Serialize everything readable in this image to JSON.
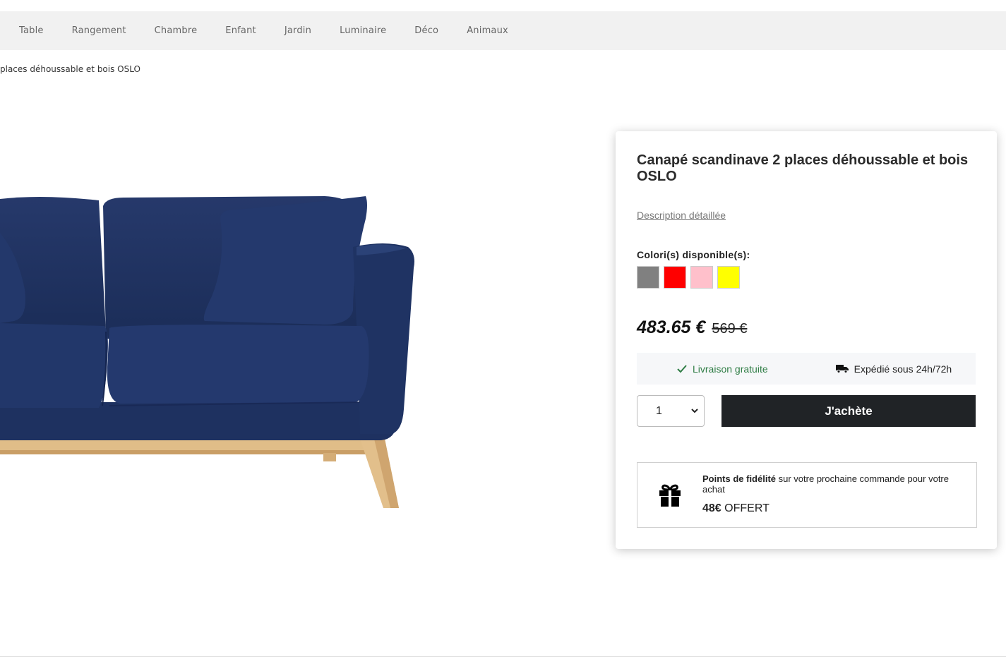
{
  "nav": {
    "items": [
      {
        "label": "Table"
      },
      {
        "label": "Rangement"
      },
      {
        "label": "Chambre"
      },
      {
        "label": "Enfant"
      },
      {
        "label": "Jardin"
      },
      {
        "label": "Luminaire"
      },
      {
        "label": "Déco"
      },
      {
        "label": "Animaux"
      }
    ]
  },
  "breadcrumb": {
    "current": "places déhoussable et bois OSLO"
  },
  "product": {
    "title": "Canapé scandinave 2 places déhoussable et bois OSLO",
    "description_link": "Description détaillée",
    "colors_label": "Colori(s) disponible(s):",
    "colors": [
      "#808080",
      "#ff0000",
      "#ffc0cb",
      "#ffff00"
    ],
    "price_current": "483.65 €",
    "price_old": "569 €",
    "shipping": {
      "free_label": "Livraison gratuite",
      "delay_label": "Expédié sous 24h/72h",
      "free_color": "#2f7d45"
    },
    "quantity": "1",
    "buy_label": "J'achète",
    "loyalty": {
      "title": "Points de fidélité",
      "text": "sur votre prochaine commande pour votre achat",
      "amount": "48€",
      "amount_suffix": "OFFERT"
    },
    "image": {
      "sofa_color": "#1f3461",
      "leg_color": "#e2bf8b"
    }
  }
}
